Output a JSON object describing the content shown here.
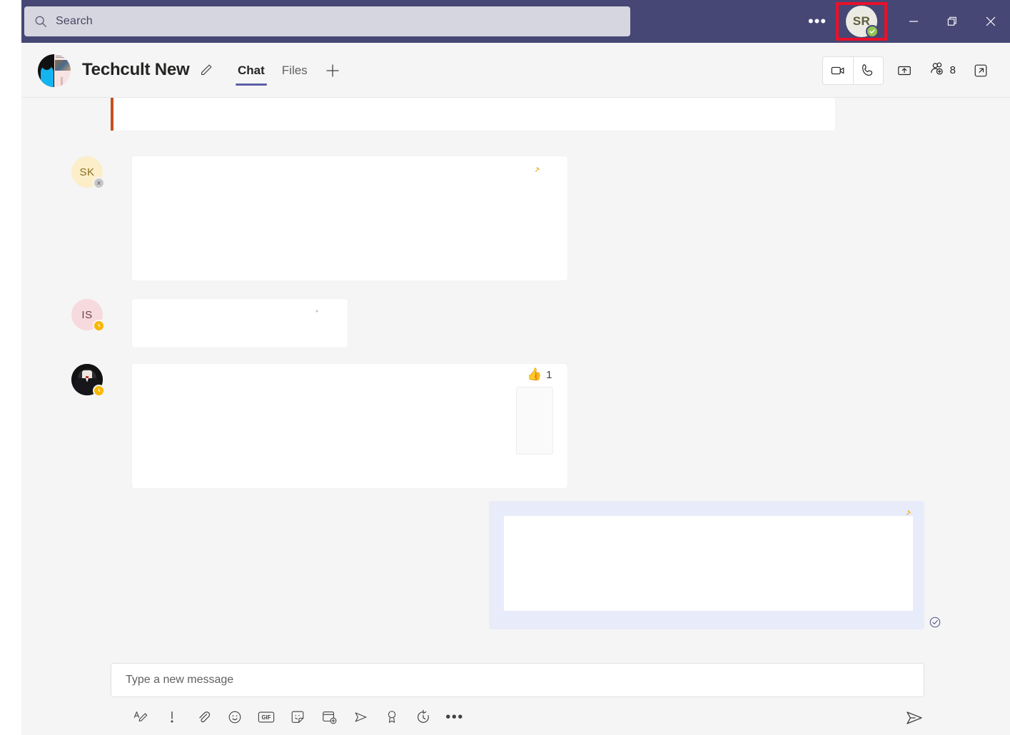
{
  "window": {
    "minimize_label": "—",
    "maximize_label": "restore-icon",
    "close_label": "✕",
    "overflow_label": "•••"
  },
  "search": {
    "placeholder": "Search",
    "value": "",
    "icon": "search-icon"
  },
  "user": {
    "initials": "SR",
    "presence": "available",
    "presence_glyph": "✓",
    "highlight_color": "#e8112b"
  },
  "header": {
    "team_name": "Techcult New",
    "edit_icon": "pencil-icon",
    "tabs": [
      {
        "label": "Chat",
        "active": true
      },
      {
        "label": "Files",
        "active": false
      }
    ],
    "add_tab_label": "+",
    "actions": {
      "video_call": "video-camera-icon",
      "audio_call": "phone-icon",
      "share_screen": "share-upload-icon",
      "add_people": "add-person-icon",
      "member_count": "8",
      "popout": "open-in-new-icon"
    }
  },
  "messages": [
    {
      "id": "msg-important-partial",
      "author_initials": "",
      "avatar_color": "",
      "presence": "",
      "important": true,
      "body": "",
      "reaction": null,
      "attachment": false
    },
    {
      "id": "msg-sk",
      "author_initials": "SK",
      "avatar_color": "#fbeec9",
      "avatar_text_color": "#8a6d1f",
      "presence": "offline",
      "presence_glyph": "✕",
      "important": false,
      "body": "",
      "reaction": null,
      "attachment": false
    },
    {
      "id": "msg-is",
      "author_initials": "IS",
      "avatar_color": "#f7dade",
      "avatar_text_color": "#6b4246",
      "presence": "away",
      "presence_glyph": "◔",
      "important": false,
      "body": "",
      "reaction": null,
      "attachment": false
    },
    {
      "id": "msg-photo",
      "author_initials": "",
      "avatar_color": "#1b1b1b",
      "avatar_text_color": "#ffffff",
      "presence": "away",
      "presence_glyph": "◔",
      "important": false,
      "body": "",
      "reaction": {
        "emoji": "👍",
        "count": "1"
      },
      "attachment": true
    }
  ],
  "outgoing": {
    "id": "msg-outgoing",
    "body": "",
    "read_receipt": "read-check-icon",
    "bubble_color": "#e8ebf9"
  },
  "compose": {
    "placeholder": "Type a new message",
    "value": "",
    "send_label": "send-icon",
    "tools": [
      {
        "name": "format-icon",
        "glyph": "format"
      },
      {
        "name": "important-icon",
        "glyph": "!"
      },
      {
        "name": "attach-icon",
        "glyph": "attach"
      },
      {
        "name": "emoji-icon",
        "glyph": "emoji"
      },
      {
        "name": "giphy-icon",
        "glyph": "GIF"
      },
      {
        "name": "sticker-icon",
        "glyph": "sticker"
      },
      {
        "name": "meet-now-icon",
        "glyph": "meet"
      },
      {
        "name": "stream-icon",
        "glyph": "stream"
      },
      {
        "name": "praise-icon",
        "glyph": "praise"
      },
      {
        "name": "schedule-send-icon",
        "glyph": "schedule"
      },
      {
        "name": "more-options-icon",
        "glyph": "•••"
      }
    ]
  },
  "colors": {
    "titlebar": "#464775",
    "search_field": "#d6d6e0",
    "canvas": "#f5f5f5",
    "accent": "#5b5fa6",
    "important_bar": "#c4511f",
    "presence_available": "#92c353",
    "presence_away": "#f8b700"
  }
}
